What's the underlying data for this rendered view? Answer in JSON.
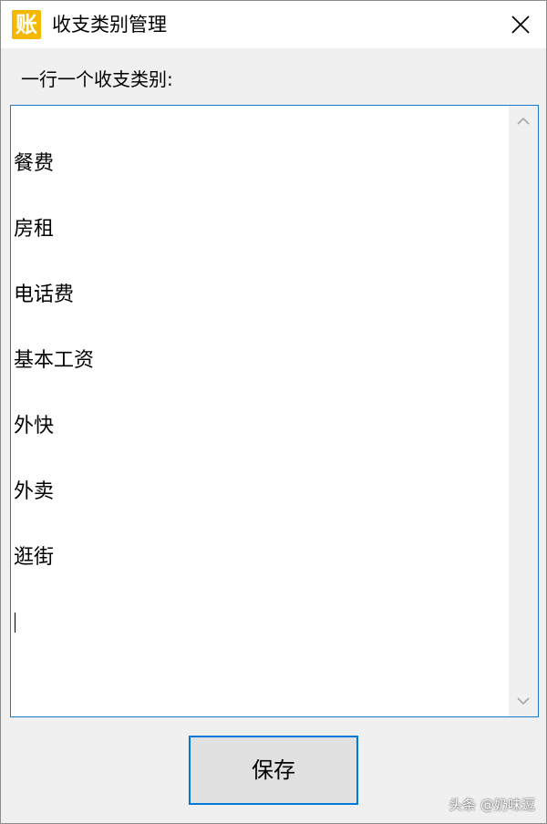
{
  "window": {
    "title": "收支类别管理",
    "icon_char": "账",
    "close_icon": "close-icon"
  },
  "prompt": {
    "label": "一行一个收支类别:"
  },
  "editor": {
    "lines": [
      "餐费",
      "房租",
      "电话费",
      "基本工资",
      "外快",
      "外卖",
      "逛街"
    ],
    "caret_on_empty_line": true
  },
  "save_button": {
    "label": "保存"
  },
  "watermark": "头条 @奶味逗",
  "colors": {
    "accent": "#0078d7",
    "icon_bg": "#f5b800"
  }
}
